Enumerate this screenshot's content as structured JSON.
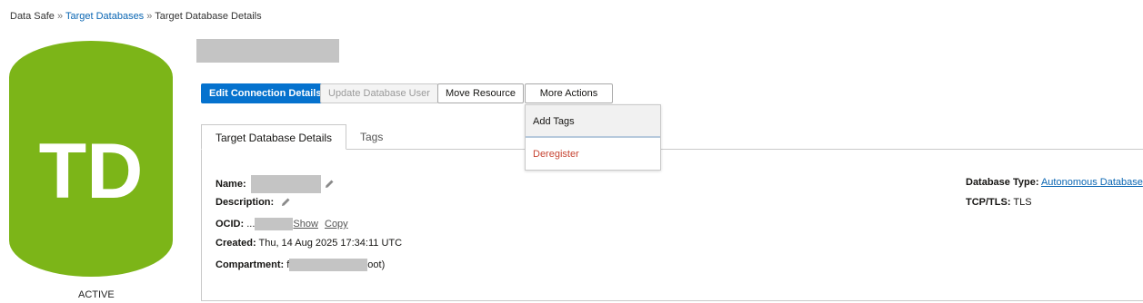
{
  "breadcrumb": {
    "root": "Data Safe",
    "sep1": "»",
    "parent": "Target Databases",
    "sep2": "»",
    "current": "Target Database Details"
  },
  "resource": {
    "initials": "TD",
    "status": "ACTIVE",
    "icon_color": "#7cb518"
  },
  "actions": {
    "edit": "Edit Connection Details",
    "update_user": "Update Database User",
    "move": "Move Resource",
    "more": "More Actions"
  },
  "more_menu": {
    "add_tags": "Add Tags",
    "deregister": "Deregister"
  },
  "tabs": [
    {
      "label": "Target Database Details"
    },
    {
      "label": "Tags"
    }
  ],
  "details": {
    "name_label": "Name:",
    "description_label": "Description:",
    "ocid_label": "OCID:",
    "ocid_prefix": "...",
    "show": "Show",
    "copy": "Copy",
    "created_label": "Created:",
    "created_value": "Thu, 14 Aug 2025 17:34:11 UTC",
    "compartment_label": "Compartment:",
    "compartment_prefix": "f",
    "compartment_suffix": "oot)",
    "database_type_label": "Database Type:",
    "database_type_value": "Autonomous Database",
    "tcp_label": "TCP/TLS:",
    "tcp_value": "TLS"
  }
}
